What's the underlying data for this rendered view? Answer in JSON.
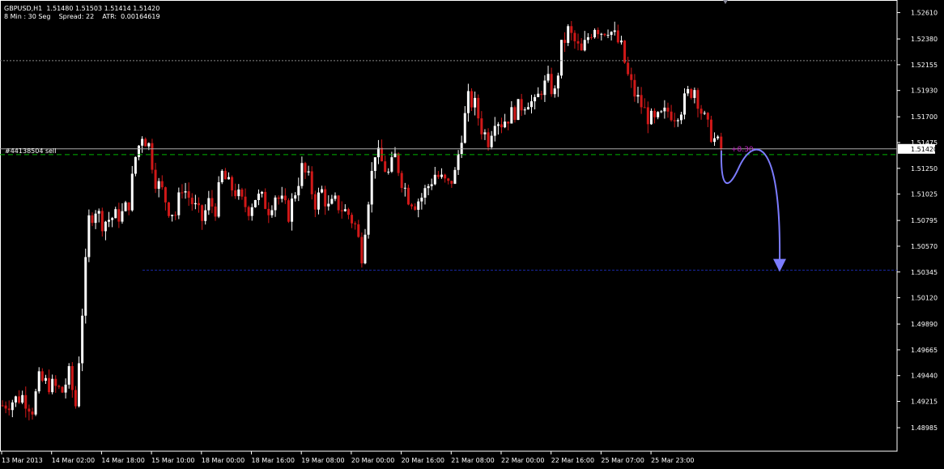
{
  "header": {
    "line1": "GBPUSD,H1  1.51480 1.51503 1.51414 1.51420",
    "line2": "8 Min : 30 Seg    Spread: 22    ATR:  0.00164619"
  },
  "order_label": "#44138504 sell",
  "profit_label": "+8.30",
  "price_label": "1.51420",
  "colors": {
    "background": "#000000",
    "bull_candle": "#ffffff",
    "bear_candle": "#d01818",
    "axis_text": "#ffffff",
    "order_line": "#00b400",
    "bid_line": "#aaaaaa",
    "resistance_line": "#888888",
    "target_line": "#1a2aa8",
    "profit_text": "#c020c0",
    "arrow": "#7c7cff"
  },
  "chart_data": {
    "type": "candlestick",
    "symbol": "GBPUSD",
    "timeframe": "H1",
    "ylim": [
      1.4878,
      1.5272
    ],
    "y_ticks": [
      "1.52610",
      "1.52380",
      "1.52155",
      "1.51930",
      "1.51700",
      "1.51475",
      "1.51250",
      "1.51025",
      "1.50795",
      "1.50570",
      "1.50345",
      "1.50120",
      "1.49890",
      "1.49665",
      "1.49440",
      "1.49215",
      "1.48985"
    ],
    "x_ticks": [
      "13 Mar 2013",
      "14 Mar 02:00",
      "14 Mar 18:00",
      "15 Mar 10:00",
      "18 Mar 00:00",
      "18 Mar 16:00",
      "19 Mar 08:00",
      "20 Mar 00:00",
      "20 Mar 16:00",
      "21 Mar 08:00",
      "22 Mar 00:00",
      "22 Mar 16:00",
      "25 Mar 07:00",
      "25 Mar 23:00"
    ],
    "levels": {
      "current_bid": 1.5142,
      "order_sell": 1.5137,
      "resistance": 1.5219,
      "target": 1.5036
    },
    "anchors": [
      [
        0,
        1.4918
      ],
      [
        6,
        1.4926
      ],
      [
        9,
        1.4915
      ],
      [
        11,
        1.494
      ],
      [
        15,
        1.4935
      ],
      [
        18,
        1.493
      ],
      [
        20,
        1.4945
      ],
      [
        22,
        1.4918
      ],
      [
        24,
        1.5
      ],
      [
        26,
        1.508
      ],
      [
        28,
        1.509
      ],
      [
        30,
        1.5078
      ],
      [
        33,
        1.5082
      ],
      [
        36,
        1.5085
      ],
      [
        38,
        1.5095
      ],
      [
        40,
        1.5135
      ],
      [
        42,
        1.5155
      ],
      [
        44,
        1.5145
      ],
      [
        46,
        1.5115
      ],
      [
        48,
        1.5105
      ],
      [
        50,
        1.509
      ],
      [
        52,
        1.5085
      ],
      [
        54,
        1.511
      ],
      [
        56,
        1.51
      ],
      [
        58,
        1.509
      ],
      [
        60,
        1.508
      ],
      [
        62,
        1.5095
      ],
      [
        64,
        1.509
      ],
      [
        66,
        1.512
      ],
      [
        68,
        1.511
      ],
      [
        70,
        1.5105
      ],
      [
        72,
        1.5095
      ],
      [
        74,
        1.509
      ],
      [
        76,
        1.51
      ],
      [
        78,
        1.5098
      ],
      [
        80,
        1.509
      ],
      [
        82,
        1.5102
      ],
      [
        84,
        1.5095
      ],
      [
        86,
        1.5085
      ],
      [
        88,
        1.5105
      ],
      [
        90,
        1.5125
      ],
      [
        92,
        1.5115
      ],
      [
        94,
        1.5095
      ],
      [
        96,
        1.5105
      ],
      [
        98,
        1.509
      ],
      [
        100,
        1.5095
      ],
      [
        102,
        1.509
      ],
      [
        104,
        1.5085
      ],
      [
        106,
        1.5075
      ],
      [
        108,
        1.505
      ],
      [
        110,
        1.51
      ],
      [
        112,
        1.514
      ],
      [
        114,
        1.513
      ],
      [
        116,
        1.512
      ],
      [
        118,
        1.5135
      ],
      [
        120,
        1.5115
      ],
      [
        122,
        1.51
      ],
      [
        124,
        1.5095
      ],
      [
        126,
        1.51
      ],
      [
        128,
        1.511
      ],
      [
        130,
        1.512
      ],
      [
        132,
        1.5115
      ],
      [
        134,
        1.511
      ],
      [
        136,
        1.512
      ],
      [
        138,
        1.5155
      ],
      [
        140,
        1.5185
      ],
      [
        142,
        1.518
      ],
      [
        144,
        1.516
      ],
      [
        146,
        1.515
      ],
      [
        148,
        1.517
      ],
      [
        150,
        1.5165
      ],
      [
        152,
        1.517
      ],
      [
        154,
        1.5175
      ],
      [
        156,
        1.518
      ],
      [
        158,
        1.5185
      ],
      [
        160,
        1.518
      ],
      [
        162,
        1.5195
      ],
      [
        164,
        1.52
      ],
      [
        166,
        1.519
      ],
      [
        168,
        1.523
      ],
      [
        170,
        1.5245
      ],
      [
        172,
        1.5235
      ],
      [
        174,
        1.5225
      ],
      [
        176,
        1.524
      ],
      [
        178,
        1.525
      ],
      [
        180,
        1.5245
      ],
      [
        182,
        1.5248
      ],
      [
        184,
        1.524
      ],
      [
        186,
        1.523
      ],
      [
        188,
        1.5205
      ],
      [
        190,
        1.519
      ],
      [
        192,
        1.518
      ],
      [
        194,
        1.517
      ],
      [
        196,
        1.5165
      ],
      [
        198,
        1.517
      ],
      [
        200,
        1.5175
      ],
      [
        202,
        1.5172
      ],
      [
        204,
        1.5178
      ],
      [
        206,
        1.519
      ],
      [
        208,
        1.5195
      ],
      [
        210,
        1.5175
      ],
      [
        212,
        1.516
      ],
      [
        214,
        1.515
      ],
      [
        216,
        1.5142
      ]
    ]
  }
}
